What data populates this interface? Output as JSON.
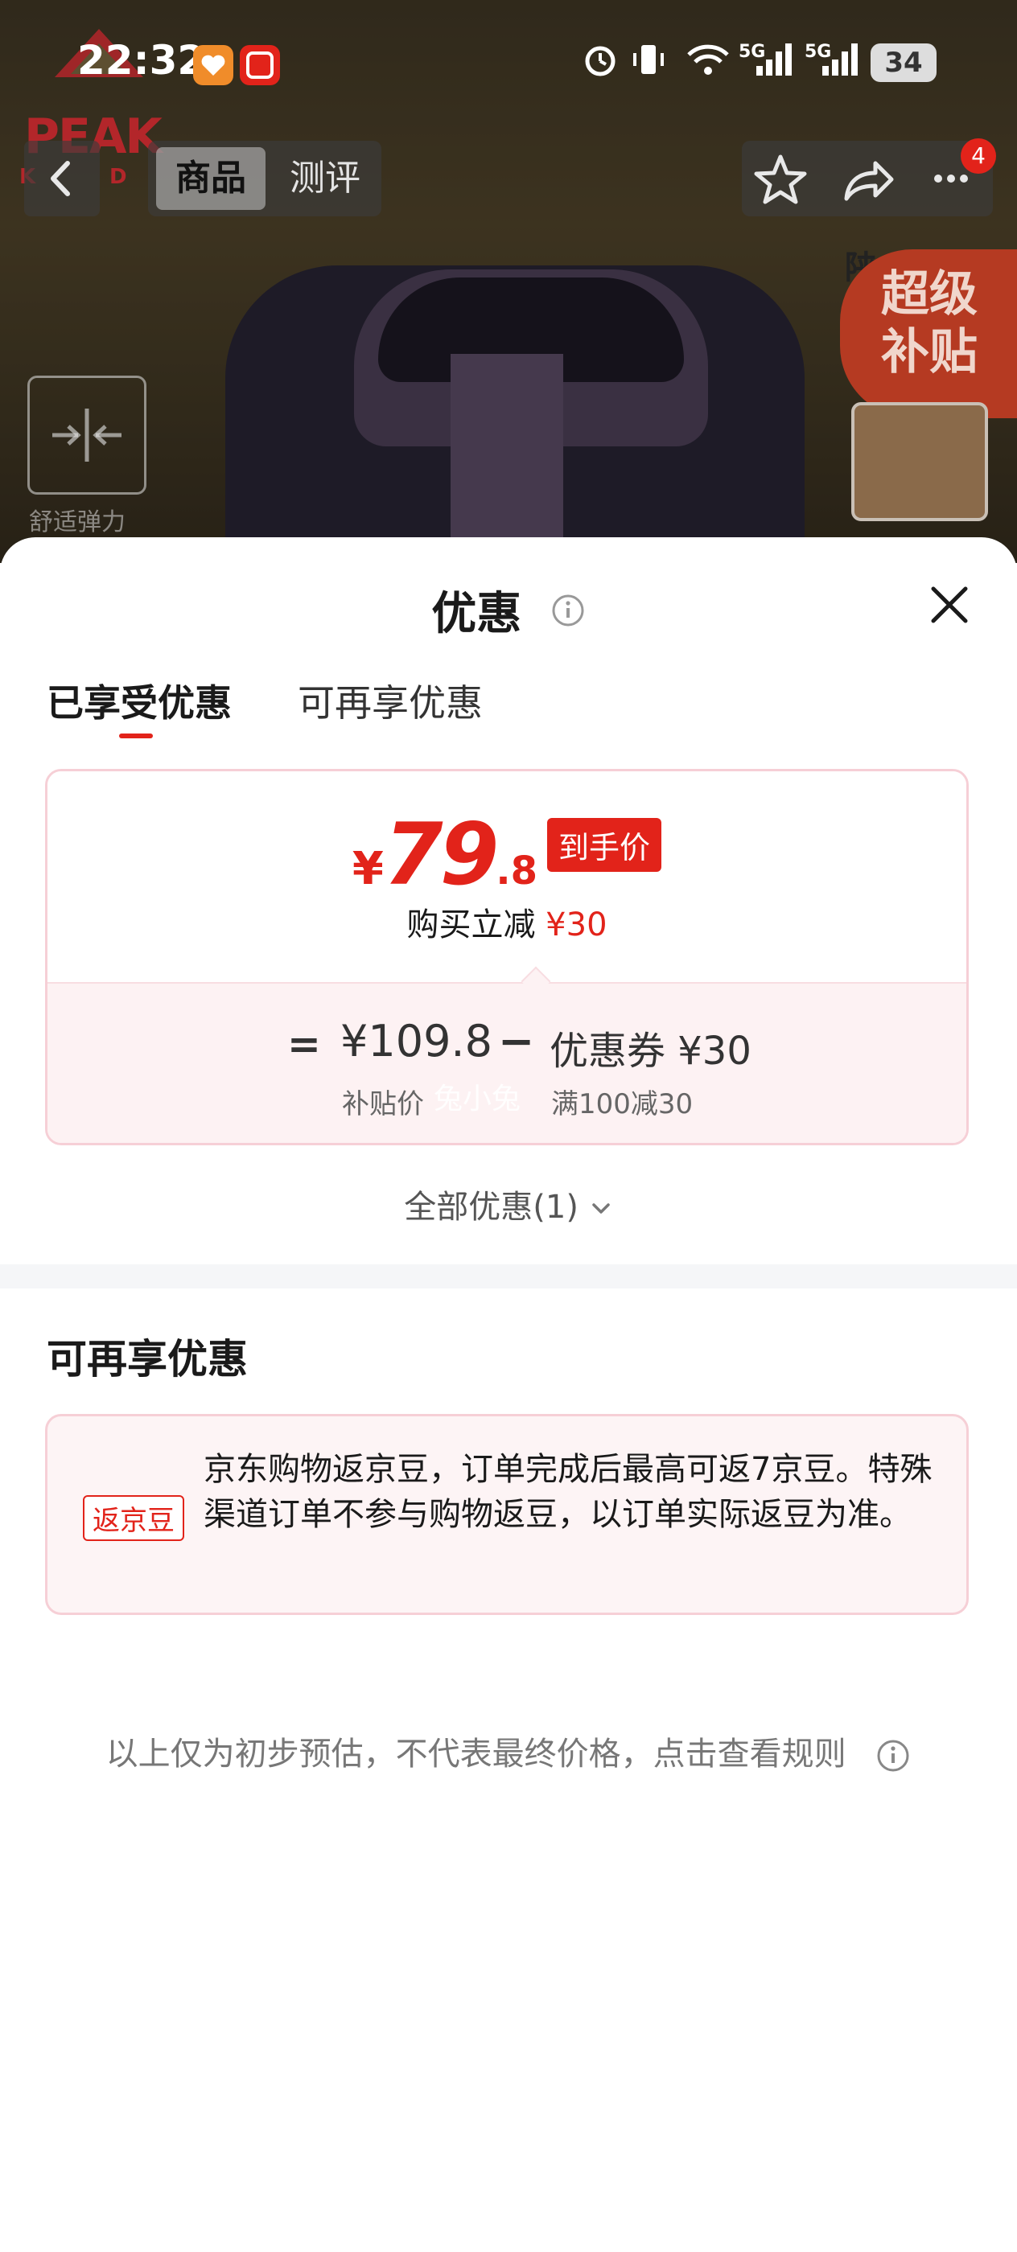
{
  "status_bar": {
    "time": "22:32",
    "network_1": "5G",
    "network_2": "5G",
    "battery": "34",
    "icons": [
      "app-heart-icon",
      "app-zhide-icon",
      "alarm-icon",
      "vibrate-icon",
      "wifi-icon",
      "signal-icon",
      "battery-icon"
    ]
  },
  "product_image": {
    "brand": "PEAK",
    "brand_sub_left": "K",
    "brand_sub_right": "D",
    "feature_label": "舒适弹力",
    "super_badge": "超级补贴",
    "thumb_text": "陕"
  },
  "nav": {
    "tabs": [
      {
        "label": "商品",
        "active": true
      },
      {
        "label": "测评",
        "active": false
      }
    ],
    "message_count": "4",
    "icons": [
      "back-icon",
      "star-icon",
      "share-icon",
      "more-icon"
    ]
  },
  "sheet": {
    "title": "优惠",
    "tabs": [
      {
        "label": "已享受优惠",
        "active": true
      },
      {
        "label": "可再享优惠",
        "active": false
      }
    ],
    "final_price": {
      "currency": "¥",
      "integer": "79",
      "decimal": ".8",
      "tag": "到手价"
    },
    "reduce": {
      "label": "购买立减",
      "amount": "¥30"
    },
    "formula": {
      "equals": "=",
      "subsidy_price": "¥109.8",
      "minus": "−",
      "coupon": "优惠券 ¥30",
      "subsidy_label": "补贴价",
      "coupon_rule": "满100减30",
      "watermark": "兔小兔"
    },
    "all_promos": "全部优惠(1)",
    "section_title": "可再享优惠",
    "beans": {
      "tag": "返京豆",
      "text": "京东购物返京豆，订单完成后最高可返7京豆。特殊渠道订单不参与购物返豆，以订单实际返豆为准。"
    },
    "disclaimer": "以上仅为初步预估，不代表最终价格，点击查看规则"
  },
  "colors": {
    "accent": "#e2231a",
    "card_border": "#f6cfd6",
    "card_bg": "#fdf2f3"
  }
}
